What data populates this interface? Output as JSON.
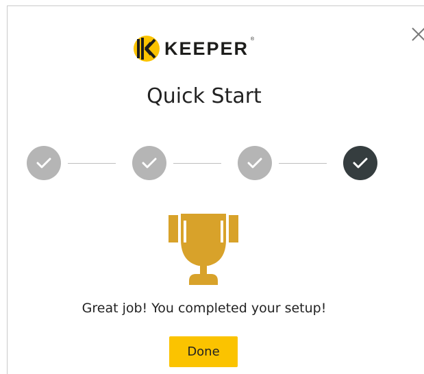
{
  "header": {
    "logo_text": "KEEPER",
    "logo_trademark": "®",
    "close_icon": "close-icon"
  },
  "dialog": {
    "title": "Quick Start",
    "steps": [
      {
        "status": "completed",
        "icon": "check-icon"
      },
      {
        "status": "completed",
        "icon": "check-icon"
      },
      {
        "status": "completed",
        "icon": "check-icon"
      },
      {
        "status": "current-completed",
        "icon": "check-icon"
      }
    ],
    "completion_icon": "trophy-icon",
    "message": "Great job! You completed your setup!",
    "done_label": "Done"
  },
  "colors": {
    "accent": "#fbc300",
    "trophy": "#d8a22a",
    "step_done": "#b5b5b5",
    "step_current": "#353d3f"
  }
}
